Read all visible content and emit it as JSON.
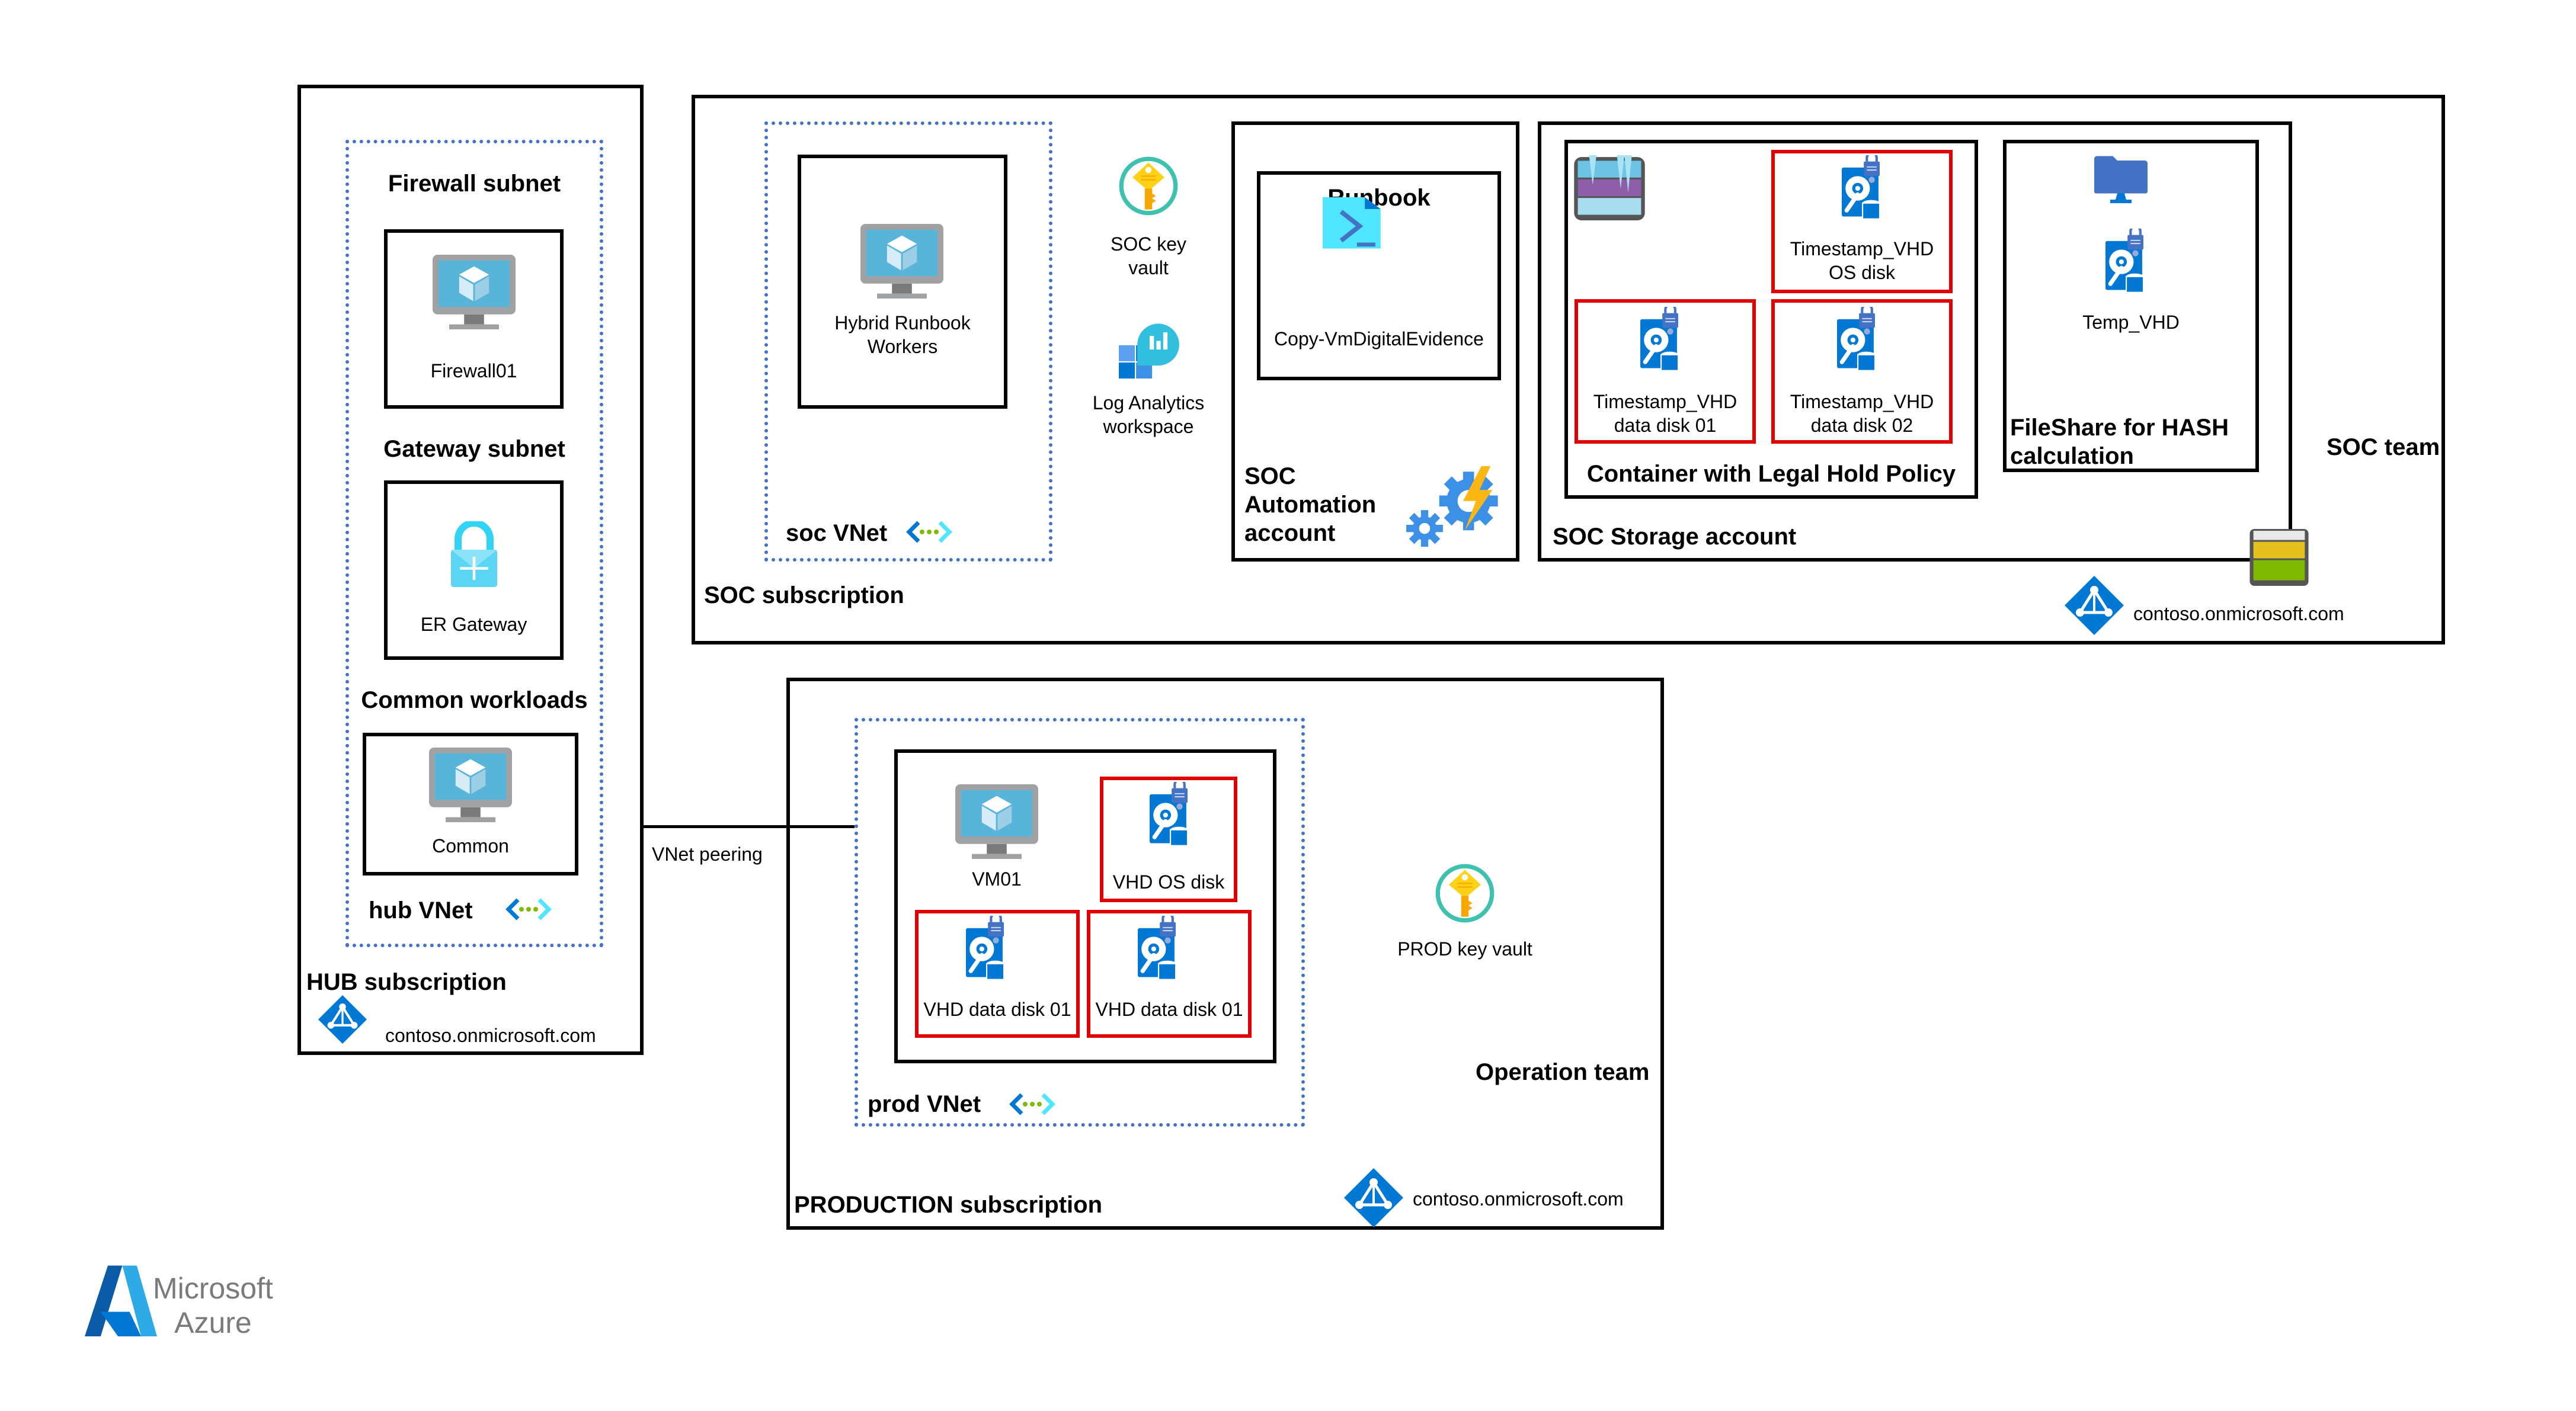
{
  "hub": {
    "subscription_label": "HUB subscription",
    "tenant": "contoso.onmicrosoft.com",
    "vnet_label": "hub VNet",
    "firewall_subnet_label": "Firewall subnet",
    "firewall_vm": "Firewall01",
    "gateway_subnet_label": "Gateway subnet",
    "gateway": "ER Gateway",
    "common_workloads_label": "Common workloads",
    "common_vm": "Common"
  },
  "peering": {
    "label": "VNet peering"
  },
  "soc": {
    "team_label": "SOC team",
    "subscription_label": "SOC subscription",
    "tenant": "contoso.onmicrosoft.com",
    "vnet_label": "soc VNet",
    "hybrid_workers": [
      "Hybrid Runbook",
      "Workers"
    ],
    "key_vault": [
      "SOC key",
      "vault"
    ],
    "log_analytics": [
      "Log Analytics",
      "workspace"
    ],
    "automation": {
      "label": [
        "SOC",
        "Automation",
        "account"
      ],
      "runbook_label": "Runbook",
      "runbook_name": "Copy-VmDigitalEvidence"
    },
    "storage": {
      "label": "SOC Storage account",
      "container_label": "Container with Legal Hold Policy",
      "disks": [
        {
          "line1": "Timestamp_VHD",
          "line2": "OS disk"
        },
        {
          "line1": "Timestamp_VHD",
          "line2": "data disk 01"
        },
        {
          "line1": "Timestamp_VHD",
          "line2": "data disk 02"
        }
      ],
      "fileshare_label": [
        "FileShare for HASH",
        "calculation"
      ],
      "temp_vhd": "Temp_VHD"
    }
  },
  "production": {
    "subscription_label": "PRODUCTION subscription",
    "team_label": "Operation team",
    "tenant": "contoso.onmicrosoft.com",
    "vnet_label": "prod VNet",
    "vm": "VM01",
    "disks": [
      "VHD OS disk",
      "VHD data disk 01",
      "VHD data disk 01"
    ],
    "key_vault": "PROD key vault"
  },
  "brand": {
    "line1": "Microsoft",
    "line2": "Azure"
  },
  "colors": {
    "border": "#000000",
    "vnet_dotted": "#4472c4",
    "evidence_red": "#e00000",
    "azure_blue": "#0078d4"
  }
}
